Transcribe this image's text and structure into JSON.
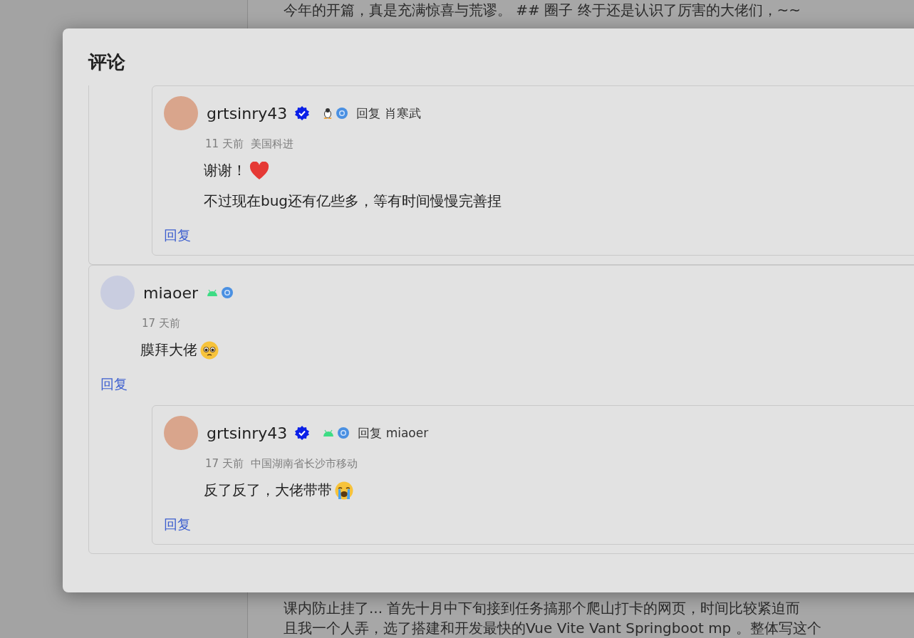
{
  "background": {
    "lines_top": [
      "今年的开篇，真是充满惊喜与荒谬。 ## 圈子 终于还是认识了厉害的大佬们，~~"
    ],
    "lines_bottom": [
      "课内防止挂了... 首先十月中下旬接到任务搞那个爬山打卡的网页，时间比较紧迫而",
      "且我一个人弄，选了搭建和开发最快的Vue Vite Vant Springboot mp 。整体写这个"
    ]
  },
  "dialog": {
    "title": "评论",
    "comments": [
      {
        "replies": [
          {
            "user": "grtsinry43",
            "verified": true,
            "icons": [
              {
                "kind": "linux"
              },
              {
                "kind": "chrome"
              }
            ],
            "reply_to_label": "回复",
            "reply_to": "肖寒武",
            "time": "11 天前",
            "location": "美国科进",
            "paragraphs": [
              {
                "text": "谢谢！",
                "emoji": {
                  "kind": "heart"
                }
              },
              {
                "text": "不过现在bug还有亿些多，等有时间慢慢完善捏"
              }
            ],
            "reply_label": "回复"
          }
        ]
      },
      {
        "user": "miaoer",
        "verified": false,
        "icons": [
          {
            "kind": "android"
          },
          {
            "kind": "chrome"
          }
        ],
        "time": "17 天前",
        "paragraphs": [
          {
            "text": "膜拜大佬",
            "emoji": {
              "kind": "pleading"
            }
          }
        ],
        "reply_label": "回复",
        "replies": [
          {
            "user": "grtsinry43",
            "verified": true,
            "icons": [
              {
                "kind": "android"
              },
              {
                "kind": "chrome"
              }
            ],
            "reply_to_label": "回复",
            "reply_to": "miaoer",
            "time": "17 天前",
            "location": "中国湖南省长沙市移动",
            "paragraphs": [
              {
                "text": "反了反了，大佬带带",
                "emoji": {
                  "kind": "crying"
                }
              }
            ],
            "reply_label": "回复"
          }
        ]
      }
    ]
  }
}
